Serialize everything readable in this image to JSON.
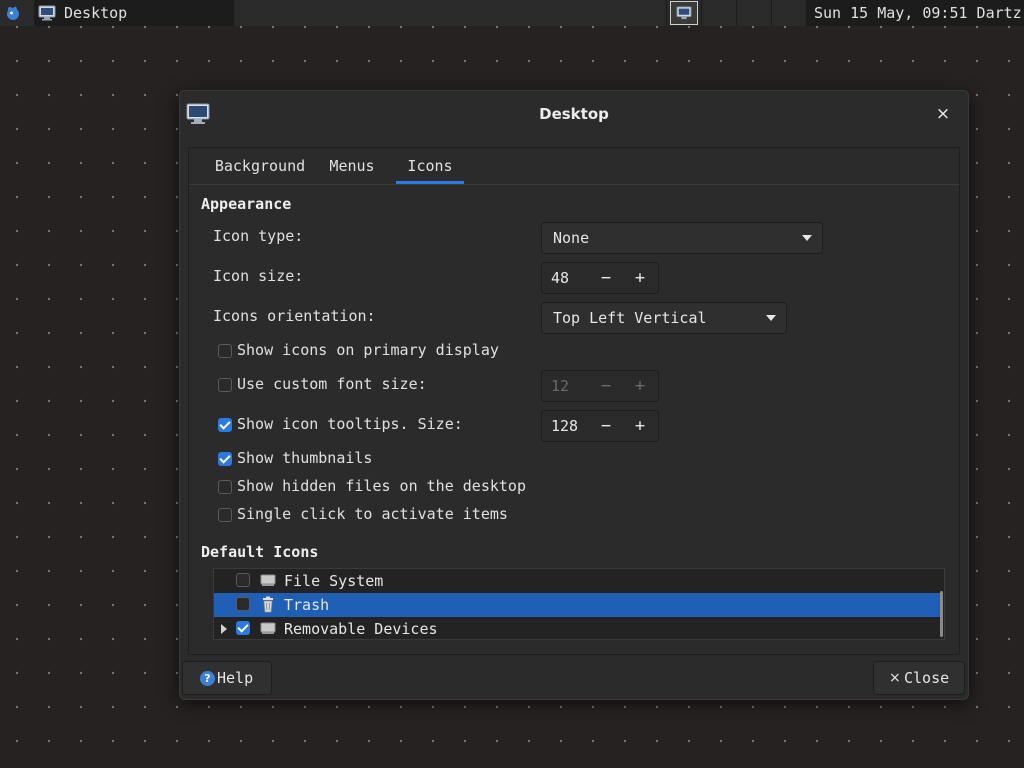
{
  "panel": {
    "task_title": "Desktop",
    "clock": "Sun 15 May, 09:51 Dartz"
  },
  "dialog": {
    "title": "Desktop",
    "close_glyph": "×",
    "tabs": [
      {
        "label": "Background",
        "active": false
      },
      {
        "label": "Menus",
        "active": false
      },
      {
        "label": "Icons",
        "active": true
      }
    ],
    "appearance": {
      "title": "Appearance",
      "icon_type": {
        "label": "Icon type:",
        "value": "None"
      },
      "icon_size": {
        "label": "Icon size:",
        "value": "48"
      },
      "orientation": {
        "label": "Icons orientation:",
        "value": "Top Left Vertical"
      },
      "show_primary": {
        "label": "Show icons on primary display",
        "checked": false
      },
      "custom_font": {
        "label": "Use custom font size:",
        "checked": false,
        "value": "12"
      },
      "tooltips": {
        "label": "Show icon tooltips. Size:",
        "checked": true,
        "value": "128"
      },
      "thumbnails": {
        "label": "Show thumbnails",
        "checked": true
      },
      "hidden_files": {
        "label": "Show hidden files on the desktop",
        "checked": false
      },
      "single_click": {
        "label": "Single click to activate items",
        "checked": false
      }
    },
    "default_icons": {
      "title": "Default Icons",
      "items": [
        {
          "label": "File System",
          "checked": false,
          "selected": false,
          "icon": "drive-icon"
        },
        {
          "label": "Trash",
          "checked": false,
          "selected": true,
          "icon": "trash-icon"
        },
        {
          "label": "Removable Devices",
          "checked": true,
          "selected": false,
          "icon": "drive-icon",
          "expandable": true
        }
      ]
    },
    "help_label": "Help",
    "close_label": "Close"
  },
  "spin_symbols": {
    "minus": "−",
    "plus": "+"
  },
  "colors": {
    "accent": "#2a7ae2",
    "selection": "#1f5fb5"
  }
}
